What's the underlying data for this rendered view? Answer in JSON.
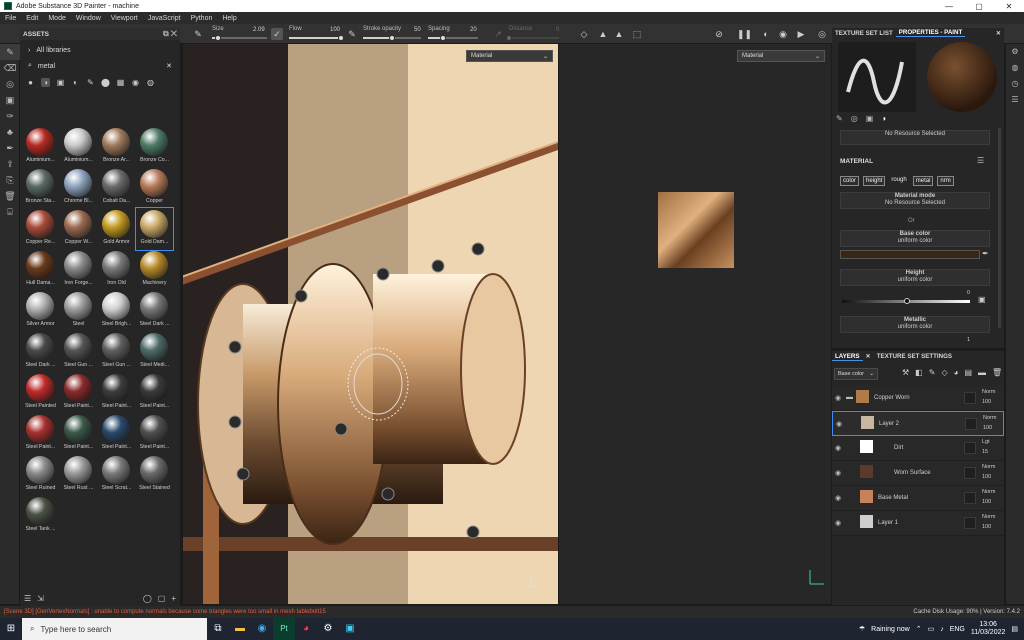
{
  "app": {
    "title": "Adobe Substance 3D Painter - machine",
    "controls": [
      "—",
      "▢",
      "✕"
    ]
  },
  "menu": [
    "File",
    "Edit",
    "Mode",
    "Window",
    "Viewport",
    "JavaScript",
    "Python",
    "Help"
  ],
  "toolbar": {
    "size": {
      "label": "Size",
      "value": "2.09",
      "level": 0.1
    },
    "flow": {
      "label": "Flow",
      "value": "100",
      "level": 1
    },
    "stroke_opacity": {
      "label": "Stroke opacity",
      "value": "50",
      "level": 0.5
    },
    "spacing": {
      "label": "Spacing",
      "value": "20",
      "level": 0.3
    },
    "distance": {
      "label": "Distance",
      "value": "0",
      "level": 0
    }
  },
  "assets": {
    "title": "ASSETS",
    "library": "All libraries",
    "search": "metal",
    "items": [
      {
        "name": "Aluminium...",
        "color": "#b52a22"
      },
      {
        "name": "Aluminium...",
        "color": "#c9c9c9"
      },
      {
        "name": "Bronze Ar...",
        "color": "#a0795a"
      },
      {
        "name": "Bronze Co...",
        "color": "#4e7a66"
      },
      {
        "name": "Bronze Sta...",
        "color": "#5a6a66"
      },
      {
        "name": "Chrome Bl...",
        "color": "#8fa3bd"
      },
      {
        "name": "Cobalt Da...",
        "color": "#6b6b6b"
      },
      {
        "name": "Copper",
        "color": "#b77b5a"
      },
      {
        "name": "Copper Re...",
        "color": "#a84a3a"
      },
      {
        "name": "Copper W...",
        "color": "#9b6a50"
      },
      {
        "name": "Gold Armor",
        "color": "#c49a22"
      },
      {
        "name": "Gold Dam...",
        "color": "#c9a96a"
      },
      {
        "name": "Hull Dama...",
        "color": "#6a3a1a"
      },
      {
        "name": "Iron Forge...",
        "color": "#8a8a8a"
      },
      {
        "name": "Iron Old",
        "color": "#7a7a7a"
      },
      {
        "name": "Machinery",
        "color": "#b88a2a"
      },
      {
        "name": "Silver Armor",
        "color": "#b0b0b0"
      },
      {
        "name": "Steel",
        "color": "#9c9c9c"
      },
      {
        "name": "Steel Brigh...",
        "color": "#cfcfcf"
      },
      {
        "name": "Steel Dark ...",
        "color": "#777777"
      },
      {
        "name": "Steel Dark ...",
        "color": "#4a4a4a"
      },
      {
        "name": "Steel Gun ...",
        "color": "#555555"
      },
      {
        "name": "Steel Gun ...",
        "color": "#606060"
      },
      {
        "name": "Steel Medi...",
        "color": "#4f6a6a"
      },
      {
        "name": "Steel Painted",
        "color": "#c12a2a"
      },
      {
        "name": "Steel Paint...",
        "color": "#8a2a2a"
      },
      {
        "name": "Steel Paint...",
        "color": "#3c3c3c"
      },
      {
        "name": "Steel Paint...",
        "color": "#3a3a3a"
      },
      {
        "name": "Steel Paint...",
        "color": "#a83030"
      },
      {
        "name": "Steel Paint...",
        "color": "#3a5a4a"
      },
      {
        "name": "Steel Paint...",
        "color": "#2a4a6a"
      },
      {
        "name": "Steel Paint...",
        "color": "#505050"
      },
      {
        "name": "Steel Ruined",
        "color": "#8a8a8a"
      },
      {
        "name": "Steel Rust ...",
        "color": "#9a9a9a"
      },
      {
        "name": "Steel Scrat...",
        "color": "#7a7a7a"
      },
      {
        "name": "Steel Stained",
        "color": "#6a6a6a"
      },
      {
        "name": "Steel Tank ...",
        "color": "#4a5244"
      }
    ]
  },
  "viewport": {
    "mode_3d": "Material",
    "mode_2d": "Material"
  },
  "properties": {
    "tab_texture_set_list": "TEXTURE SET LIST",
    "tab_properties": "PROPERTIES - PAINT",
    "no_resource": "No Resource Selected",
    "material_heading": "MATERIAL",
    "channels": [
      "color",
      "height",
      "rough",
      "metal",
      "nrm"
    ],
    "material_mode_label": "Material mode",
    "material_mode_value": "No Resource Selected",
    "or": "Or",
    "base_color_label": "Base color",
    "base_color_value": "uniform color",
    "base_color_hex": "#3a2615",
    "height_label": "Height",
    "height_value": "uniform color",
    "height_number": "0",
    "metallic_label": "Metallic",
    "metallic_value": "uniform color",
    "metallic_number": "1"
  },
  "layers": {
    "tab_layers": "LAYERS",
    "tab_settings": "TEXTURE SET SETTINGS",
    "channel": "Base color",
    "items": [
      {
        "name": "Copper Worn",
        "blend": "Norm",
        "opacity": "100",
        "color": "#b07a4a"
      },
      {
        "name": "Layer 2",
        "blend": "Norm",
        "opacity": "100",
        "color": "#c8b6a0"
      },
      {
        "name": "Dirt",
        "blend": "Lgt",
        "opacity": "15",
        "color": "#ffffff"
      },
      {
        "name": "Worn Surface",
        "blend": "Norm",
        "opacity": "100",
        "color": "#5a3a2a"
      },
      {
        "name": "Base Metal",
        "blend": "Norm",
        "opacity": "100",
        "color": "#c8825a"
      },
      {
        "name": "Layer 1",
        "blend": "Norm",
        "opacity": "100",
        "color": "#cfcfcf"
      }
    ]
  },
  "status": {
    "error": "[Scene 3D] [GenVertexNormals] : unable to compute normals because some triangles were too small in mesh tablebolt15",
    "info": "Cache Disk Usage:  90% | Version: 7.4.2"
  },
  "taskbar": {
    "search": "Type here to search",
    "weather": "Raining now",
    "lang": "ENG",
    "time": "13:06",
    "date": "11/03/2022"
  }
}
